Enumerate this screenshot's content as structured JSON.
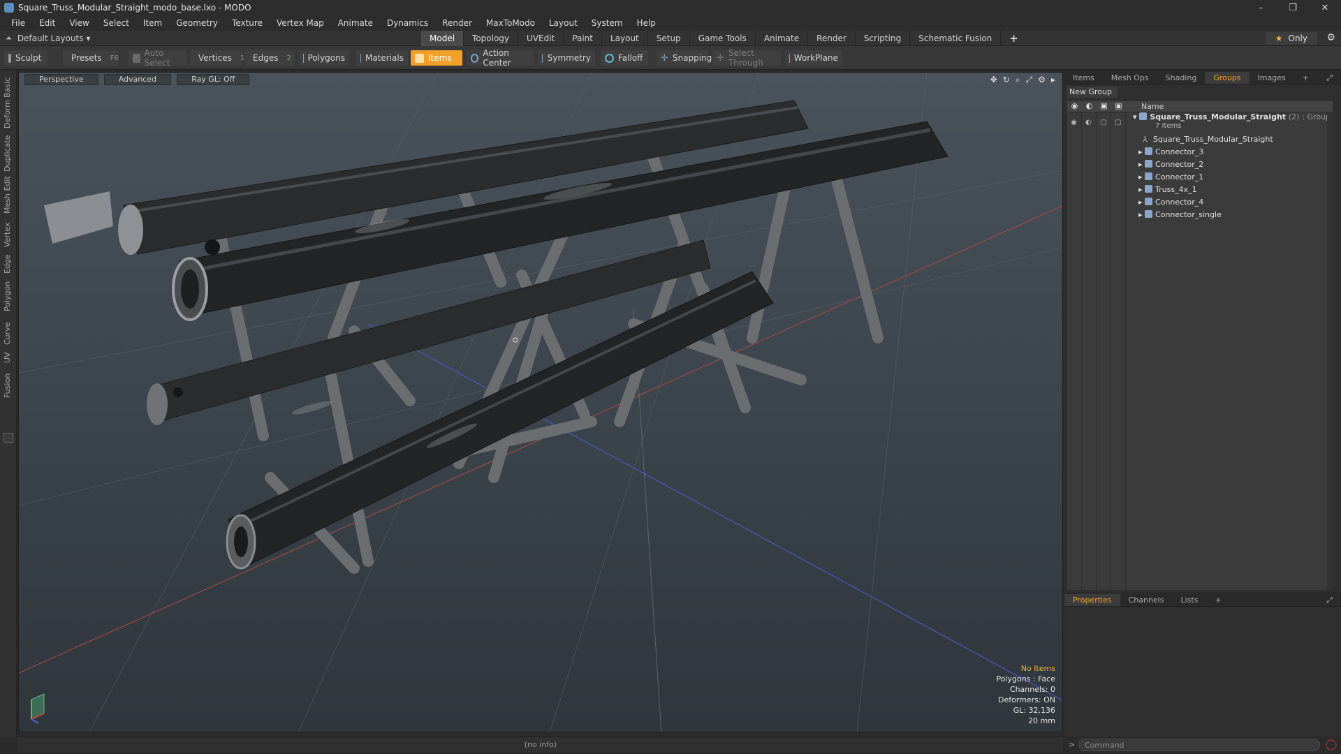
{
  "window": {
    "title": "Square_Truss_Modular_Straight_modo_base.lxo - MODO",
    "controls": [
      "–",
      "❐",
      "✕"
    ]
  },
  "menu": [
    "File",
    "Edit",
    "View",
    "Select",
    "Item",
    "Geometry",
    "Texture",
    "Vertex Map",
    "Animate",
    "Dynamics",
    "Render",
    "MaxToModo",
    "Layout",
    "System",
    "Help"
  ],
  "layouts": {
    "label": "Default Layouts ▾"
  },
  "mode_tabs": [
    "Model",
    "Topology",
    "UVEdit",
    "Paint",
    "Layout",
    "Setup",
    "Game Tools",
    "Animate",
    "Render",
    "Scripting",
    "Schematic Fusion"
  ],
  "mode_tabs_active": "Model",
  "only_button": "Only",
  "toolbar": {
    "sculpt": "Sculpt",
    "presets": "Presets",
    "presets_key": "F6",
    "auto_select": "Auto Select",
    "vertices": "Vertices",
    "vertices_key": "1",
    "edges": "Edges",
    "edges_key": "2",
    "polygons": "Polygons",
    "materials": "Materials",
    "items": "Items",
    "action_center": "Action Center",
    "symmetry": "Symmetry",
    "falloff": "Falloff",
    "snapping": "Snapping",
    "select_through": "Select Through",
    "workplane": "WorkPlane"
  },
  "left_tabs": [
    "Basic",
    "Deform",
    "Duplicate",
    "Mesh Edit",
    "Vertex",
    "Edge",
    "Polygon",
    "Curve",
    "UV",
    "Fusion"
  ],
  "viewport": {
    "view": "Perspective",
    "shading": "Advanced",
    "raygl": "Ray GL: Off",
    "stats": {
      "no_items": "No Items",
      "polygons": "Polygons : Face",
      "channels": "Channels: 0",
      "deformers": "Deformers: ON",
      "gl": "GL: 32,136",
      "scale": "20 mm"
    }
  },
  "info_bar": "(no info)",
  "right_panel": {
    "tabs": [
      "Items",
      "Mesh Ops",
      "Shading",
      "Groups",
      "Images"
    ],
    "active_tab": "Groups",
    "new_group": "New Group",
    "name_header": "Name",
    "group": {
      "name": "Square_Truss_Modular_Straight",
      "count": "(2)",
      "type": ": Group",
      "sub": "7 Items"
    },
    "items": [
      "Square_Truss_Modular_Straight",
      "Connector_3",
      "Connector_2",
      "Connector_1",
      "Truss_4x_1",
      "Connector_4",
      "Connector_single"
    ]
  },
  "props_panel": {
    "tabs": [
      "Properties",
      "Channels",
      "Lists"
    ],
    "active_tab": "Properties"
  },
  "command": {
    "placeholder": "Command"
  },
  "colors": {
    "accent": "#f0a12a",
    "viewport_top": "#4a535b",
    "viewport_bottom": "#2f363c"
  }
}
